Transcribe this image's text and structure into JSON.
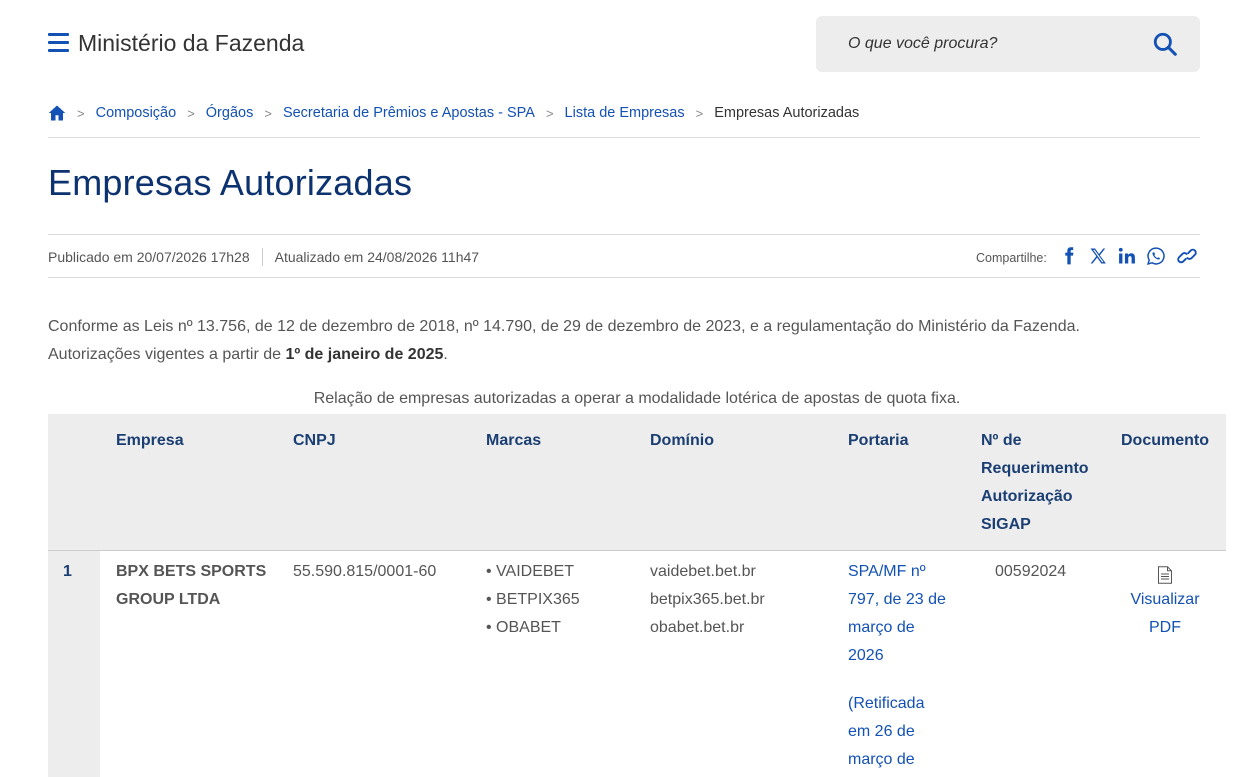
{
  "header": {
    "site_title": "Ministério da Fazenda",
    "search_placeholder": "O que você procura?"
  },
  "breadcrumb": {
    "items": [
      "Composição",
      "Órgãos",
      "Secretaria de Prêmios e Apostas - SPA",
      "Lista de Empresas"
    ],
    "current": "Empresas Autorizadas"
  },
  "page": {
    "title": "Empresas Autorizadas",
    "published": "Publicado em 20/07/2026 17h28",
    "updated": "Atualizado em 24/08/2026 11h47",
    "share_label": "Compartilhe:"
  },
  "intro": {
    "line1": "Conforme as Leis nº 13.756, de 12 de dezembro de 2018, nº 14.790, de 29 de dezembro de 2023, e a regulamentação do Ministério da Fazenda.",
    "line2_prefix": "Autorizações vigentes a partir de ",
    "line2_bold": "1º de janeiro de 2025",
    "line2_suffix": "."
  },
  "table": {
    "caption": "Relação de empresas autorizadas a operar a modalidade lotérica de apostas de quota fixa.",
    "headers": {
      "empresa": "Empresa",
      "cnpj": "CNPJ",
      "marcas": "Marcas",
      "dominio": "Domínio",
      "portaria": "Portaria",
      "requerimento": [
        "Nº de",
        "Requerimento",
        "Autorização",
        "SIGAP"
      ],
      "documento": "Documento"
    },
    "rows": [
      {
        "index": "1",
        "empresa": [
          "BPX BETS SPORTS",
          "GROUP LTDA"
        ],
        "cnpj": "55.590.815/0001-60",
        "marcas": [
          "• VAIDEBET",
          "• BETPIX365",
          "• OBABET"
        ],
        "dominios": [
          "vaidebet.bet.br",
          "betpix365.bet.br",
          "obabet.bet.br"
        ],
        "portaria": [
          "SPA/MF nº",
          "797, de 23 de",
          "março de",
          "2026"
        ],
        "retificada": [
          "(Retificada",
          "em 26 de",
          "março de"
        ],
        "requerimento": "00592024",
        "documento": [
          "Visualizar",
          "PDF"
        ]
      }
    ]
  },
  "colors": {
    "primary": "#1351b4",
    "title": "#0c326f",
    "header_text": "#1b3f73",
    "table_bg": "#ededed"
  }
}
